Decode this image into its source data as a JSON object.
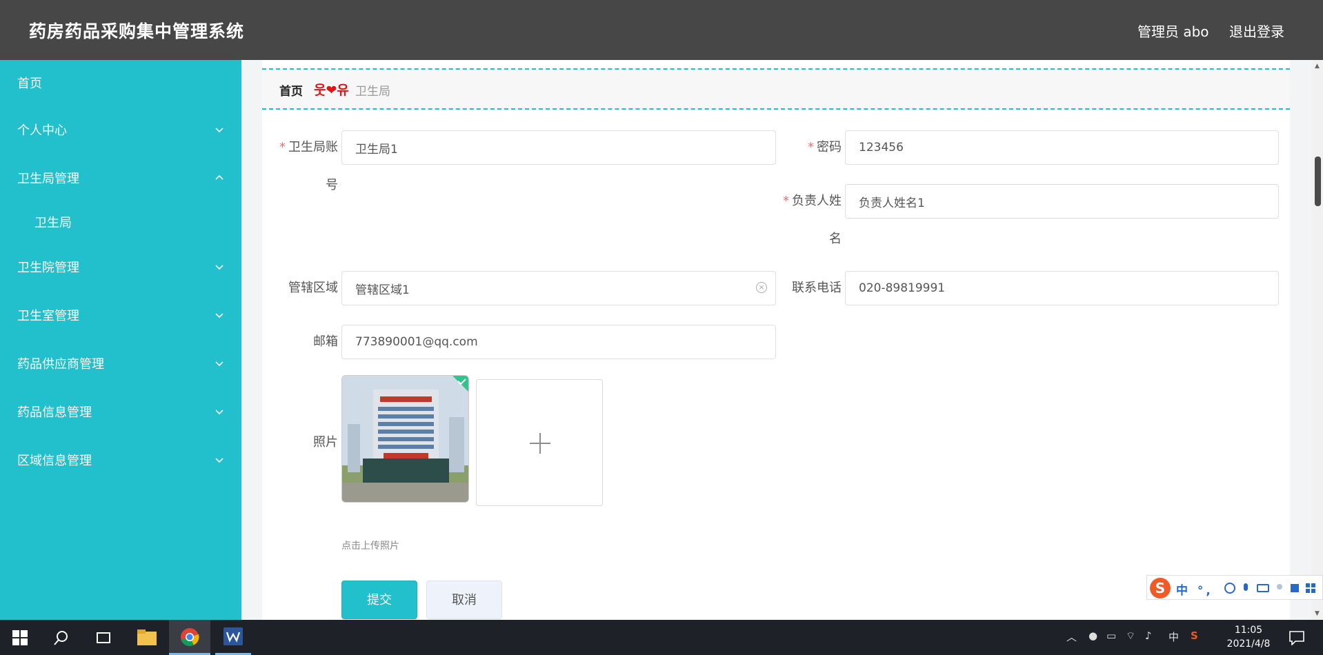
{
  "header": {
    "app_title": "药房药品采购集中管理系统",
    "admin_label": "管理员 abo",
    "logout_label": "退出登录"
  },
  "sidebar": {
    "items": [
      {
        "label": "首页"
      },
      {
        "label": "个人中心",
        "icon": "chevron-down-icon"
      },
      {
        "label": "卫生局管理",
        "icon": "chevron-up-icon"
      },
      {
        "label": "卫生局"
      },
      {
        "label": "卫生院管理",
        "icon": "chevron-down-icon"
      },
      {
        "label": "卫生室管理",
        "icon": "chevron-down-icon"
      },
      {
        "label": "药品供应商管理",
        "icon": "chevron-down-icon"
      },
      {
        "label": "药品信息管理",
        "icon": "chevron-down-icon"
      },
      {
        "label": "区域信息管理",
        "icon": "chevron-down-icon"
      }
    ]
  },
  "breadcrumb": {
    "home": "首页",
    "separator": "웃❤유",
    "current": "卫生局"
  },
  "form": {
    "account": {
      "label_line1": "卫生局账",
      "label_line2": "号",
      "value": "卫生局1"
    },
    "password": {
      "label": "密码",
      "value": "123456"
    },
    "manager_name": {
      "label_line1": "负责人姓",
      "label_line2": "名",
      "value": "负责人姓名1"
    },
    "region": {
      "label": "管辖区域",
      "value": "管辖区域1"
    },
    "phone": {
      "label": "联系电话",
      "value": "020-89819991"
    },
    "email": {
      "label": "邮箱",
      "value": "773890001@qq.com"
    },
    "photo": {
      "label": "照片",
      "hint": "点击上传照片"
    },
    "submit_label": "提交",
    "cancel_label": "取消",
    "required_mark": "*"
  },
  "ime": {
    "text": "中 °,"
  },
  "taskbar": {
    "time": "11:05",
    "date": "2021/4/8",
    "lang": "中"
  },
  "colors": {
    "accent": "#22bfcc",
    "header_bg": "#474747",
    "required": "#f56c6c"
  }
}
